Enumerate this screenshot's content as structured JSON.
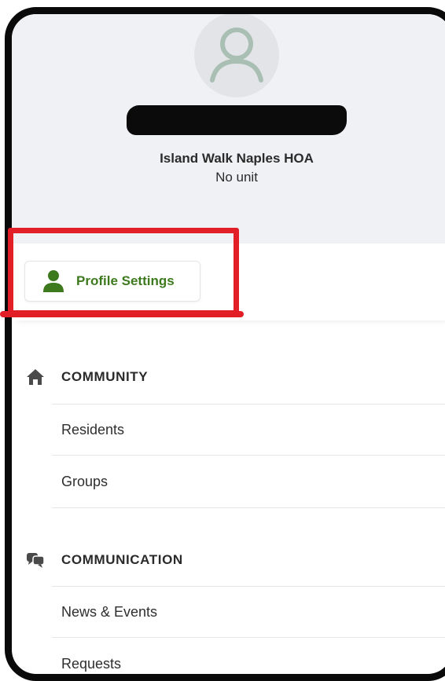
{
  "profile": {
    "organization": "Island Walk Naples HOA",
    "unit": "No unit",
    "settings_button": "Profile Settings"
  },
  "sections": {
    "community": {
      "title": "COMMUNITY",
      "items": [
        {
          "label": "Residents"
        },
        {
          "label": "Groups"
        }
      ]
    },
    "communication": {
      "title": "COMMUNICATION",
      "items": [
        {
          "label": "News & Events"
        },
        {
          "label": "Requests"
        }
      ]
    }
  },
  "colors": {
    "accent_green": "#3d7a1e",
    "highlight_red": "#e21e26",
    "header_bg": "#f0f1f5"
  },
  "icons": {
    "avatar": "user-outline-icon",
    "profile": "person-icon",
    "community": "home-icon",
    "communication": "chat-bubbles-icon"
  }
}
